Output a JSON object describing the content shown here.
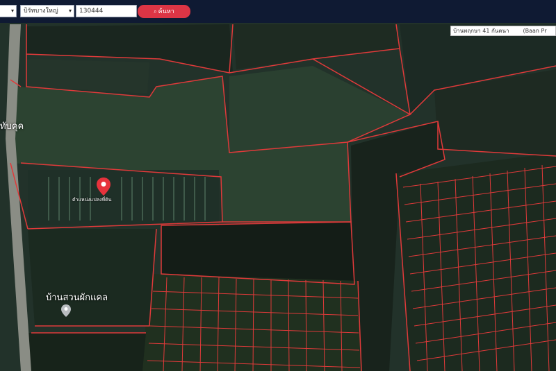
{
  "toolbar": {
    "district_select": "",
    "subdistrict_select": "บิรัทบางใหญ่",
    "parcel_input": "130444",
    "search_button": "ค้นหา"
  },
  "map": {
    "search_result_th": "บ้านพฤกษา 41 กันตนา",
    "search_result_en": "(Baan Pr",
    "pin_label": "ตำแหน่งแปลงที่ดิน",
    "place_label": "บ้านสวนผักแคล",
    "road_label": "ทับคุค",
    "parcel_color": "#e03a3a",
    "accent_color": "#dc3545"
  }
}
